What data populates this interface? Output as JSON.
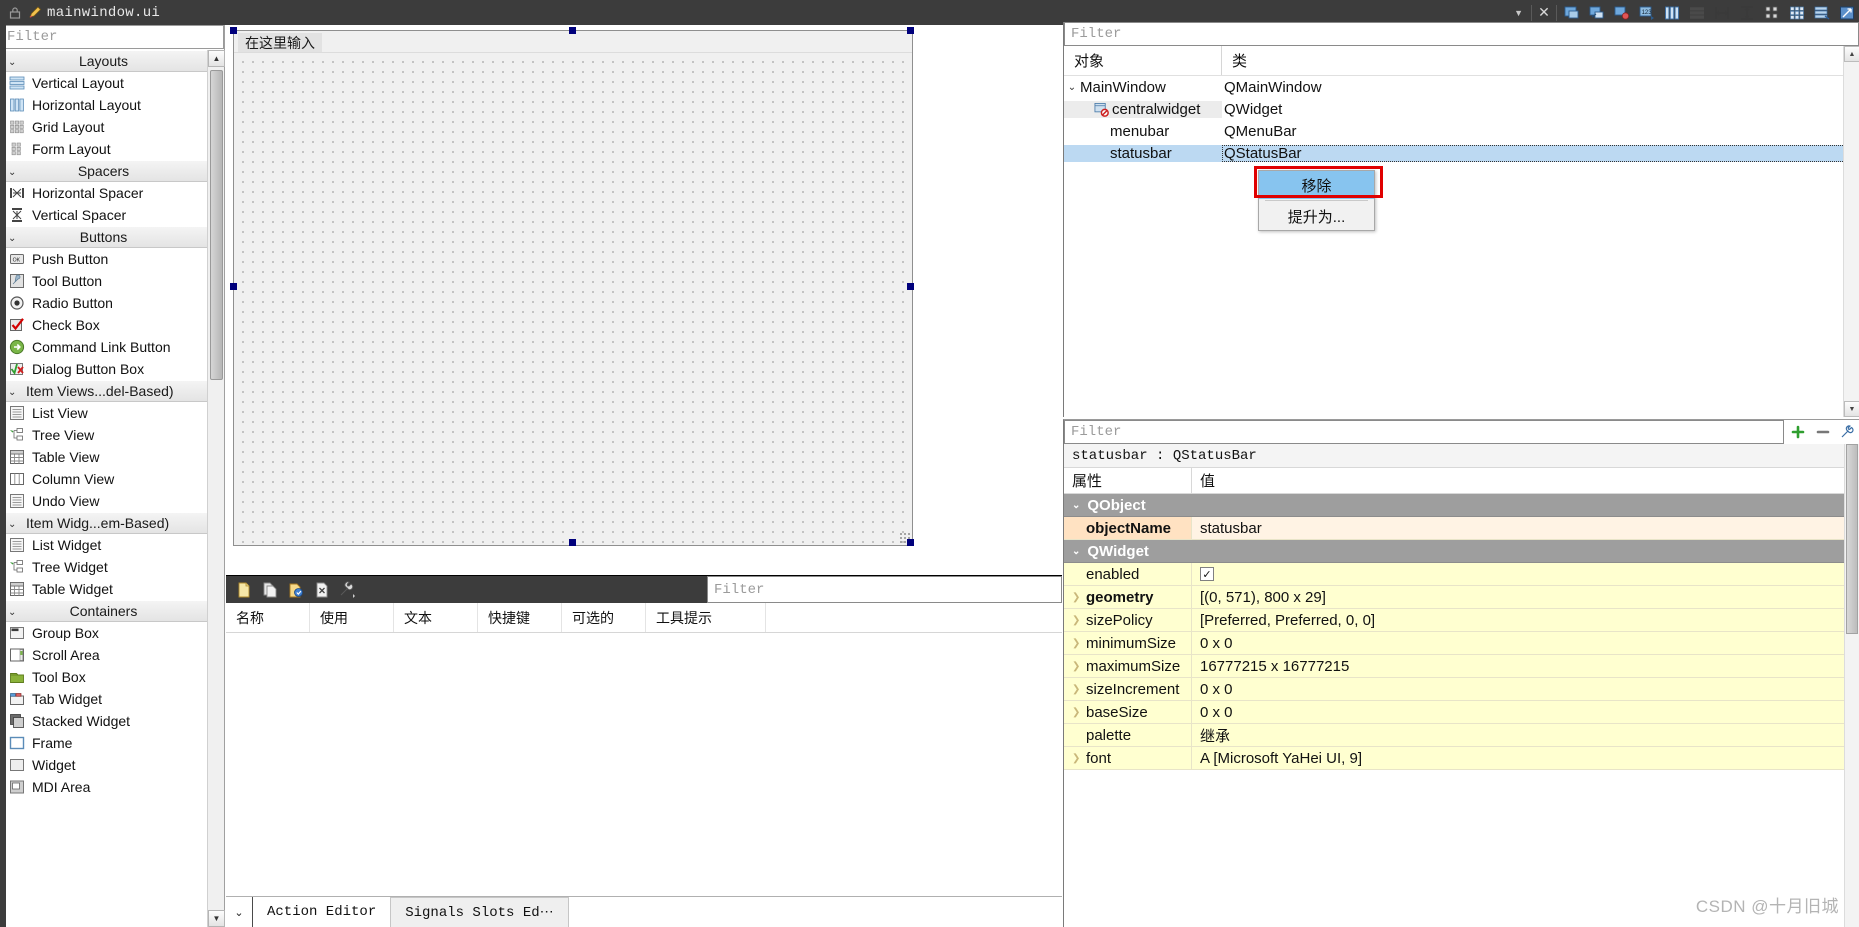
{
  "titlebar": {
    "filename": "mainwindow.ui",
    "lock_icon": "lock-icon",
    "doc_icon": "ui-document-icon",
    "dropdown_icon": "chevron-down-icon",
    "close_icon": "close-icon",
    "tools": [
      {
        "name": "edit-widgets-icon"
      },
      {
        "name": "edit-signals-slots-icon"
      },
      {
        "name": "edit-buddies-icon"
      },
      {
        "name": "edit-tab-order-icon"
      },
      {
        "name": "lay-out-horizontally-icon"
      },
      {
        "name": "lay-out-vertically-icon"
      },
      {
        "name": "lay-out-in-splitter-horizontal-icon"
      },
      {
        "name": "lay-out-in-splitter-vertical-icon"
      },
      {
        "name": "lay-out-in-form-layout-icon"
      },
      {
        "name": "lay-out-in-grid-icon"
      },
      {
        "name": "break-layout-icon"
      },
      {
        "name": "adjust-size-icon"
      }
    ]
  },
  "widgetbox": {
    "filter_placeholder": "Filter",
    "groups": [
      {
        "label": "Layouts",
        "align": "center",
        "items": [
          {
            "label": "Vertical Layout",
            "icon": "vertical-layout-icon"
          },
          {
            "label": "Horizontal Layout",
            "icon": "horizontal-layout-icon"
          },
          {
            "label": "Grid Layout",
            "icon": "grid-layout-icon"
          },
          {
            "label": "Form Layout",
            "icon": "form-layout-icon"
          }
        ]
      },
      {
        "label": "Spacers",
        "align": "center",
        "items": [
          {
            "label": "Horizontal Spacer",
            "icon": "horizontal-spacer-icon"
          },
          {
            "label": "Vertical Spacer",
            "icon": "vertical-spacer-icon"
          }
        ]
      },
      {
        "label": "Buttons",
        "align": "center",
        "items": [
          {
            "label": "Push Button",
            "icon": "push-button-icon"
          },
          {
            "label": "Tool Button",
            "icon": "tool-button-icon"
          },
          {
            "label": "Radio Button",
            "icon": "radio-button-icon"
          },
          {
            "label": "Check Box",
            "icon": "check-box-icon"
          },
          {
            "label": "Command Link Button",
            "icon": "command-link-button-icon"
          },
          {
            "label": "Dialog Button Box",
            "icon": "dialog-button-box-icon"
          }
        ]
      },
      {
        "label": "Item Views...del-Based)",
        "align": "left",
        "items": [
          {
            "label": "List View",
            "icon": "list-view-icon"
          },
          {
            "label": "Tree View",
            "icon": "tree-view-icon"
          },
          {
            "label": "Table View",
            "icon": "table-view-icon"
          },
          {
            "label": "Column View",
            "icon": "column-view-icon"
          },
          {
            "label": "Undo View",
            "icon": "undo-view-icon"
          }
        ]
      },
      {
        "label": "Item Widg...em-Based)",
        "align": "left",
        "items": [
          {
            "label": "List Widget",
            "icon": "list-widget-icon"
          },
          {
            "label": "Tree Widget",
            "icon": "tree-widget-icon"
          },
          {
            "label": "Table Widget",
            "icon": "table-widget-icon"
          }
        ]
      },
      {
        "label": "Containers",
        "align": "center",
        "items": [
          {
            "label": "Group Box",
            "icon": "group-box-icon"
          },
          {
            "label": "Scroll Area",
            "icon": "scroll-area-icon"
          },
          {
            "label": "Tool Box",
            "icon": "tool-box-icon"
          },
          {
            "label": "Tab Widget",
            "icon": "tab-widget-icon"
          },
          {
            "label": "Stacked Widget",
            "icon": "stacked-widget-icon"
          },
          {
            "label": "Frame",
            "icon": "frame-icon"
          },
          {
            "label": "Widget",
            "icon": "widget-icon"
          },
          {
            "label": "MDI Area",
            "icon": "mdi-area-icon"
          }
        ]
      }
    ]
  },
  "canvas": {
    "menu_placeholder": "在这里输入"
  },
  "action_editor": {
    "toolbar": [
      {
        "name": "new-action-icon"
      },
      {
        "name": "copy-action-icon"
      },
      {
        "name": "edit-action-icon"
      },
      {
        "name": "delete-action-icon"
      },
      {
        "name": "configure-action-icon"
      }
    ],
    "filter_placeholder": "Filter",
    "columns": [
      "名称",
      "使用",
      "文本",
      "快捷键",
      "可选的",
      "工具提示"
    ],
    "rows": [],
    "bottom_chevron": "chevron-down-icon",
    "tabs": [
      {
        "label": "Action Editor",
        "active": true
      },
      {
        "label": "Signals  Slots Ed⋯",
        "active": false
      }
    ]
  },
  "object_inspector": {
    "filter_placeholder": "Filter",
    "columns": [
      "对象",
      "类"
    ],
    "rows": [
      {
        "object": "MainWindow",
        "class": "QMainWindow",
        "indent": 0,
        "expander": "chevron-down-icon",
        "icon": "",
        "state": "normal"
      },
      {
        "object": "centralwidget",
        "class": "QWidget",
        "indent": 1,
        "expander": "",
        "icon": "central-widget-icon",
        "state": "hover"
      },
      {
        "object": "menubar",
        "class": "QMenuBar",
        "indent": 1,
        "expander": "",
        "icon": "",
        "state": "normal"
      },
      {
        "object": "statusbar",
        "class": "QStatusBar",
        "indent": 1,
        "expander": "",
        "icon": "",
        "state": "selected"
      }
    ],
    "scroll_up_icon": "chevron-up-icon",
    "scroll_down_icon": "chevron-down-icon"
  },
  "context_menu": {
    "items": [
      {
        "label": "移除",
        "highlighted": true
      },
      {
        "label": "提升为...",
        "highlighted": false
      }
    ],
    "highlight_color": "#e00000"
  },
  "property_editor": {
    "filter_placeholder": "Filter",
    "toolbar": [
      {
        "name": "add-dynamic-property-icon"
      },
      {
        "name": "remove-dynamic-property-icon"
      },
      {
        "name": "configure-property-editor-icon"
      }
    ],
    "object_line": "statusbar : QStatusBar",
    "columns": [
      "属性",
      "值"
    ],
    "groups": [
      {
        "name": "QObject",
        "expander": "chevron-down-icon",
        "rows": [
          {
            "name": "objectName",
            "value": "statusbar",
            "style": "peach",
            "bold": true,
            "expandable": false,
            "kind": "text"
          }
        ]
      },
      {
        "name": "QWidget",
        "expander": "chevron-down-icon",
        "rows": [
          {
            "name": "enabled",
            "value": "",
            "style": "yellow",
            "bold": false,
            "expandable": false,
            "kind": "checkbox",
            "checked": true
          },
          {
            "name": "geometry",
            "value": "[(0, 571), 800 x 29]",
            "style": "yellow",
            "bold": true,
            "expandable": true,
            "kind": "text"
          },
          {
            "name": "sizePolicy",
            "value": "[Preferred, Preferred, 0, 0]",
            "style": "yellow",
            "bold": false,
            "expandable": true,
            "kind": "text"
          },
          {
            "name": "minimumSize",
            "value": "0 x 0",
            "style": "yellow",
            "bold": false,
            "expandable": true,
            "kind": "text"
          },
          {
            "name": "maximumSize",
            "value": "16777215 x 16777215",
            "style": "yellow",
            "bold": false,
            "expandable": true,
            "kind": "text"
          },
          {
            "name": "sizeIncrement",
            "value": "0 x 0",
            "style": "yellow",
            "bold": false,
            "expandable": true,
            "kind": "text"
          },
          {
            "name": "baseSize",
            "value": "0 x 0",
            "style": "yellow",
            "bold": false,
            "expandable": true,
            "kind": "text"
          },
          {
            "name": "palette",
            "value": "继承",
            "style": "yellow",
            "bold": false,
            "expandable": false,
            "kind": "text"
          },
          {
            "name": "font",
            "value": "A  [Microsoft YaHei UI, 9]",
            "style": "yellow",
            "bold": false,
            "expandable": true,
            "kind": "text"
          }
        ]
      }
    ]
  },
  "watermark": "CSDN @十月旧城"
}
